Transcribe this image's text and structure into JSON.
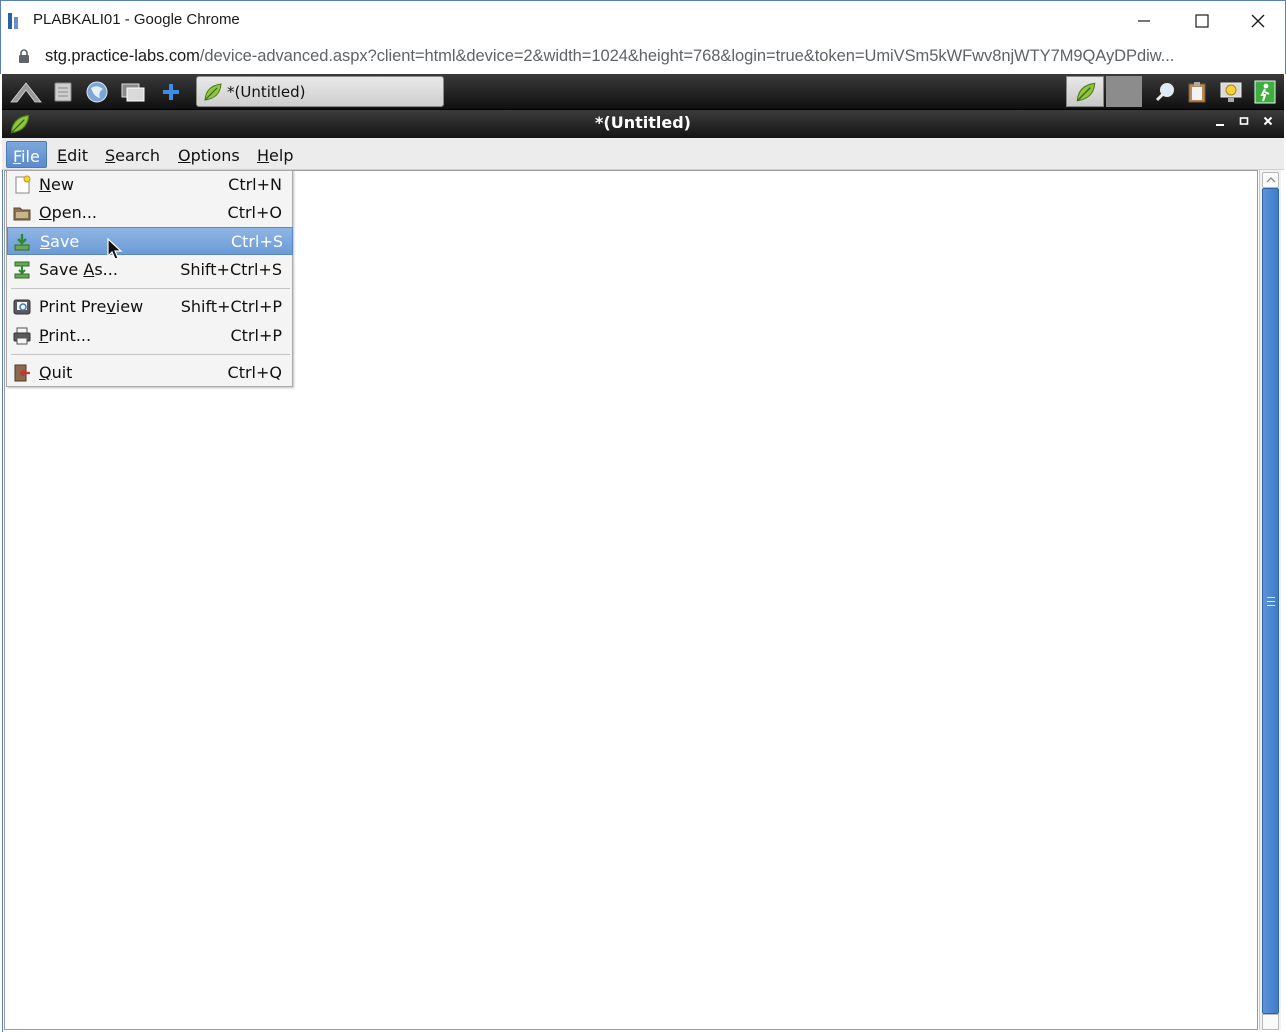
{
  "browser": {
    "window_title": "PLABKALI01 - Google Chrome",
    "url_host": "stg.practice-labs.com",
    "url_path": "/device-advanced.aspx?client=html&device=2&width=1024&height=768&login=true&token=UmiVSm5kWFwv8njWTY7M9QAyDPdiw..."
  },
  "panel": {
    "task_label": "*(Untitled)",
    "launchers": [
      "kali-menu-icon",
      "file-manager-icon",
      "browser-icon",
      "windows-icon",
      "add-icon"
    ],
    "tray": [
      "leafpad-icon",
      "search-icon",
      "clipboard-icon",
      "display-icon",
      "exit-icon"
    ]
  },
  "app": {
    "title": "*(Untitled)",
    "menubar": {
      "items": [
        {
          "label": "File",
          "mnemonic": "F",
          "rest": "ile"
        },
        {
          "label": "Edit",
          "mnemonic": "E",
          "rest": "dit"
        },
        {
          "label": "Search",
          "mnemonic": "S",
          "rest": "earch"
        },
        {
          "label": "Options",
          "mnemonic": "O",
          "rest": "ptions"
        },
        {
          "label": "Help",
          "mnemonic": "H",
          "rest": "elp"
        }
      ],
      "active": "File"
    },
    "file_menu": {
      "items": [
        {
          "pre": "",
          "mn": "N",
          "post": "ew",
          "accel": "Ctrl+N",
          "icon": "new-document-icon"
        },
        {
          "pre": "",
          "mn": "O",
          "post": "pen...",
          "accel": "Ctrl+O",
          "icon": "open-folder-icon"
        },
        {
          "pre": "",
          "mn": "S",
          "post": "ave",
          "accel": "Ctrl+S",
          "icon": "save-icon",
          "highlighted": true
        },
        {
          "pre": "Save ",
          "mn": "A",
          "post": "s...",
          "accel": "Shift+Ctrl+S",
          "icon": "save-as-icon"
        },
        {
          "pre": "Print Pre",
          "mn": "v",
          "post": "iew",
          "accel": "Shift+Ctrl+P",
          "icon": "print-preview-icon"
        },
        {
          "pre": "",
          "mn": "P",
          "post": "rint...",
          "accel": "Ctrl+P",
          "icon": "print-icon"
        },
        {
          "pre": "",
          "mn": "Q",
          "post": "uit",
          "accel": "Ctrl+Q",
          "icon": "quit-icon"
        }
      ]
    },
    "editor_text": ""
  },
  "colors": {
    "menu_highlight": "#6c9bd6",
    "panel_bg": "#1e1e1e",
    "scroll_thumb": "#3e7ccb"
  }
}
